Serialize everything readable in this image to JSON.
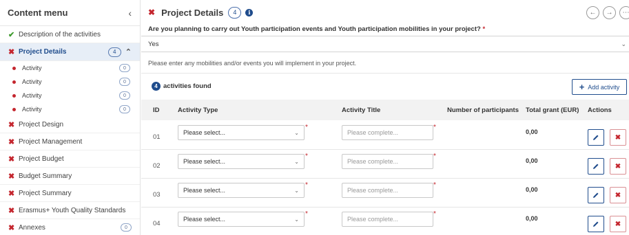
{
  "sidebar": {
    "title": "Content menu",
    "collapse_icon": "chevron-left-icon",
    "items": [
      {
        "label": "Description of the activities",
        "status": "complete"
      },
      {
        "label": "Project Details",
        "status": "error",
        "count": "4",
        "expanded": true,
        "subitems": [
          {
            "label": "Activity",
            "count": "0"
          },
          {
            "label": "Activity",
            "count": "0"
          },
          {
            "label": "Activity",
            "count": "0"
          },
          {
            "label": "Activity",
            "count": "0"
          }
        ]
      },
      {
        "label": "Project Design",
        "status": "error"
      },
      {
        "label": "Project Management",
        "status": "error"
      },
      {
        "label": "Project Budget",
        "status": "error"
      },
      {
        "label": "Budget Summary",
        "status": "error"
      },
      {
        "label": "Project Summary",
        "status": "error"
      },
      {
        "label": "Erasmus+ Youth Quality Standards",
        "status": "error"
      },
      {
        "label": "Annexes",
        "status": "error",
        "count": "0"
      }
    ]
  },
  "header": {
    "title": "Project Details",
    "count": "4",
    "info_icon": "info-icon",
    "prev_icon": "arrow-left-icon",
    "next_icon": "arrow-right-icon"
  },
  "question": {
    "text": "Are you planning to carry out Youth participation events and Youth participation mobilities in your project?",
    "required_mark": "*",
    "value": "Yes"
  },
  "hint": "Please enter any mobilities and/or events you will implement in your project.",
  "activities": {
    "found_count": "4",
    "found_text": "activities found",
    "add_button": "Add activity",
    "columns": [
      "ID",
      "Activity Type",
      "Activity Title",
      "Number of participants",
      "Total grant (EUR)",
      "Actions"
    ],
    "rows": [
      {
        "id": "01",
        "type": "Please select...",
        "title_placeholder": "Please complete...",
        "participants": "",
        "grant": "0,00"
      },
      {
        "id": "02",
        "type": "Please select...",
        "title_placeholder": "Please complete...",
        "participants": "",
        "grant": "0,00"
      },
      {
        "id": "03",
        "type": "Please select...",
        "title_placeholder": "Please complete...",
        "participants": "",
        "grant": "0,00"
      },
      {
        "id": "04",
        "type": "Please select...",
        "title_placeholder": "Please complete...",
        "participants": "",
        "grant": "0,00"
      }
    ],
    "required_mark": "*"
  },
  "colors": {
    "primary": "#1f4c8c",
    "error": "#c4262e",
    "success": "#3d9a2c",
    "active_bg": "#e7eef7"
  }
}
